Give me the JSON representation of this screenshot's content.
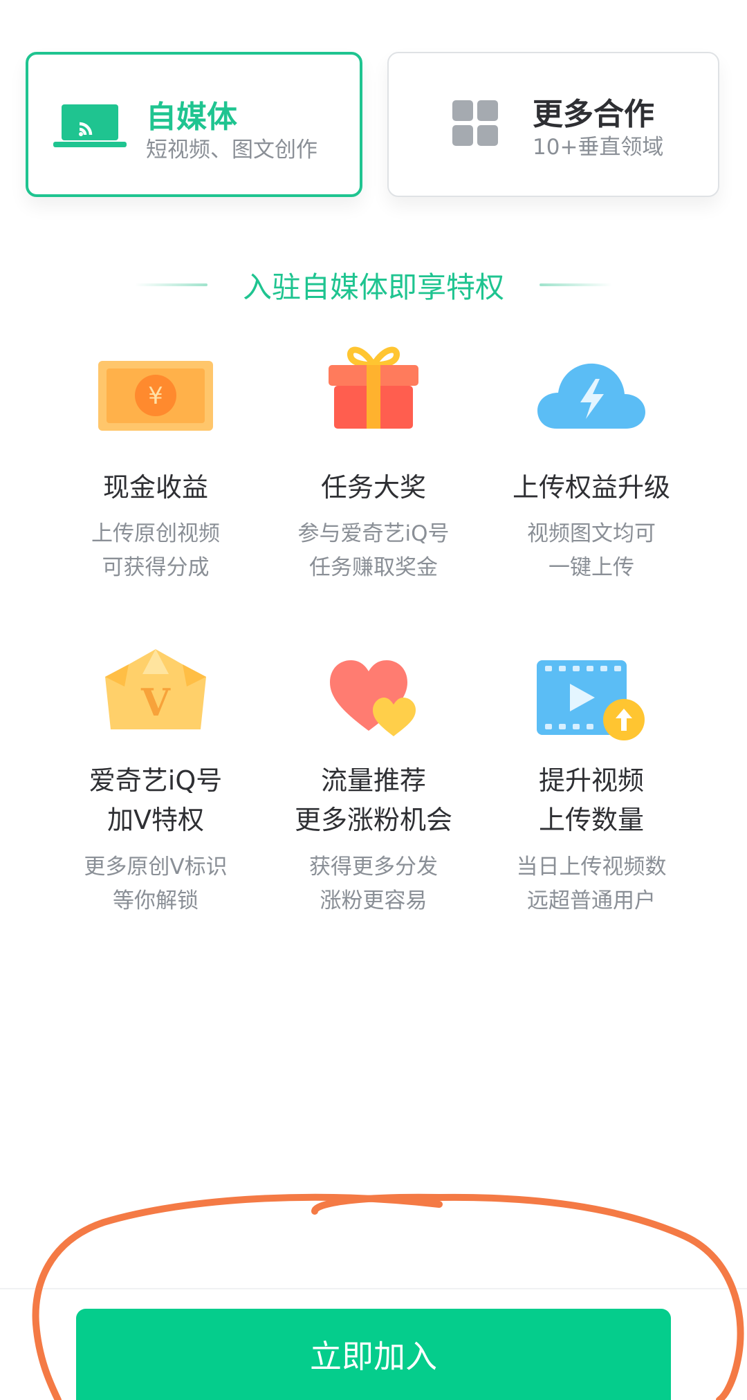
{
  "tabs": [
    {
      "title": "自媒体",
      "subtitle": "短视频、图文创作",
      "icon": "laptop-cast-icon",
      "selected": true
    },
    {
      "title": "更多合作",
      "subtitle": "10+垂直领域",
      "icon": "grid-icon",
      "selected": false
    }
  ],
  "section_title": "入驻自媒体即享特权",
  "benefits": [
    {
      "icon": "cash-bill-icon",
      "title": "现金收益",
      "desc_line1": "上传原创视频",
      "desc_line2": "可获得分成"
    },
    {
      "icon": "gift-icon",
      "title": "任务大奖",
      "desc_line1": "参与爱奇艺iQ号",
      "desc_line2": "任务赚取奖金"
    },
    {
      "icon": "cloud-lightning-icon",
      "title": "上传权益升级",
      "desc_line1": "视频图文均可",
      "desc_line2": "一键上传"
    },
    {
      "icon": "crown-icon",
      "title_line1": "爱奇艺iQ号",
      "title_line2": "加V特权",
      "desc_line1": "更多原创V标识",
      "desc_line2": "等你解锁"
    },
    {
      "icon": "hearts-icon",
      "title_line1": "流量推荐",
      "title_line2": "更多涨粉机会",
      "desc_line1": "获得更多分发",
      "desc_line2": "涨粉更容易"
    },
    {
      "icon": "video-upload-icon",
      "title_line1": "提升视频",
      "title_line2": "上传数量",
      "desc_line1": "当日上传视频数",
      "desc_line2": "远超普通用户"
    }
  ],
  "join_button_label": "立即加入",
  "colors": {
    "accent": "#1fc490",
    "button": "#05cd8c",
    "text_primary": "#2e2f33",
    "text_secondary": "#8a8f96",
    "annotation": "#f47a45"
  }
}
